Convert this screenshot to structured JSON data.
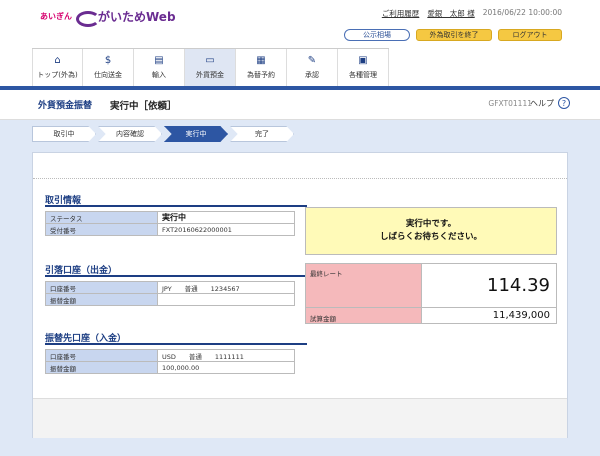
{
  "header": {
    "bank_name": "あいぎん",
    "app_name": "がいためWeb",
    "links": {
      "history": "ご利用履歴",
      "user": "愛銀　太郎 様",
      "datetime": "2016/06/22 10:00:00"
    },
    "buttons": {
      "rates": "公示相場",
      "exit": "外為取引を終了",
      "logout": "ログアウト"
    }
  },
  "nav": {
    "items": [
      {
        "label": "トップ(外為)",
        "icon": "home-icon"
      },
      {
        "label": "仕向送金",
        "icon": "remittance-icon"
      },
      {
        "label": "輸入",
        "icon": "import-icon"
      },
      {
        "label": "外貨預金",
        "icon": "deposit-icon",
        "active": true
      },
      {
        "label": "為替予約",
        "icon": "forward-icon"
      },
      {
        "label": "承認",
        "icon": "approval-icon"
      },
      {
        "label": "各種管理",
        "icon": "management-icon"
      }
    ]
  },
  "title": {
    "section": "外貨預金振替",
    "status": "実行中［依頼］",
    "code": "GFXT01111",
    "help": "ヘルプ",
    "help_icon": "?"
  },
  "steps": [
    "取引中",
    "内容確認",
    "実行中",
    "完了"
  ],
  "transaction": {
    "heading": "取引情報",
    "rows": [
      {
        "label": "ステータス",
        "value": "実行中"
      },
      {
        "label": "受付番号",
        "value": "FXT20160622000001"
      }
    ]
  },
  "debit": {
    "heading": "引落口座（出金）",
    "rows": [
      {
        "label": "口座番号",
        "value": "JPY　　普通　　1234567"
      },
      {
        "label": "振替金額",
        "value": ""
      }
    ]
  },
  "credit": {
    "heading": "振替先口座（入金）",
    "rows": [
      {
        "label": "口座番号",
        "value": "USD　　普通　　1111111"
      },
      {
        "label": "振替金額",
        "value": "100,000.00"
      }
    ]
  },
  "message": {
    "line1": "実行中です。",
    "line2": "しばらくお待ちください。"
  },
  "rate": {
    "label": "最終レート",
    "value": "114.39",
    "calc_label": "試算金額",
    "calc_value": "11,439,000"
  },
  "colors": {
    "brand": "#6a2c91",
    "accent": "#2d56a3",
    "highlight": "#fffab8",
    "rate_bg": "#f5b9bb"
  }
}
